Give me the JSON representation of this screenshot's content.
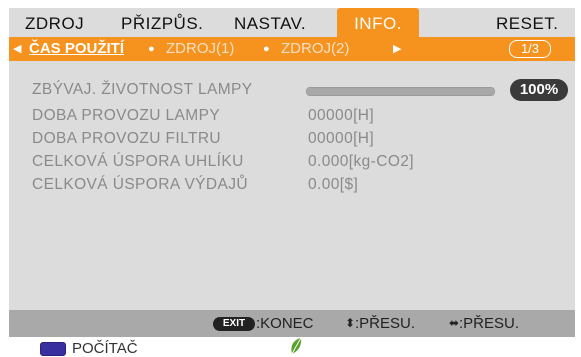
{
  "tabs": [
    {
      "label": "ZDROJ"
    },
    {
      "label": "PŘIZPŮS."
    },
    {
      "label": "NASTAV."
    },
    {
      "label": "INFO."
    },
    {
      "label": "RESET."
    }
  ],
  "subtabs": {
    "active": "ČAS POUŽITÍ",
    "others": [
      "ZDROJ(1)",
      "ZDROJ(2)"
    ],
    "page": "1/3"
  },
  "info": {
    "lamp_life": {
      "label": "ZBÝVAJ. ŽIVOTNOST LAMPY",
      "value": "100%",
      "fraction": 1.0
    },
    "lamp_hours": {
      "label": "DOBA PROVOZU LAMPY",
      "value": "00000[H]"
    },
    "filter_hours": {
      "label": "DOBA PROVOZU FILTRU",
      "value": "00000[H]"
    },
    "carbon": {
      "label": "CELKOVÁ ÚSPORA UHLÍKU",
      "value": "0.000[kg-CO2]"
    },
    "cost": {
      "label": "CELKOVÁ ÚSPORA VÝDAJŮ",
      "value": "0.00[$]"
    }
  },
  "footer": {
    "exit_key": "EXIT",
    "exit_label": ":KONEC",
    "move_ud": ":PŘESU.",
    "move_lr": ":PŘESU."
  },
  "status": {
    "source": "POČÍTAČ"
  },
  "colors": {
    "accent": "#f6921e",
    "panel": "#dcdcdc",
    "footer": "#a9a9a9",
    "monitor": "#3a2f9f",
    "eco_leaf": "#5aa02c"
  }
}
